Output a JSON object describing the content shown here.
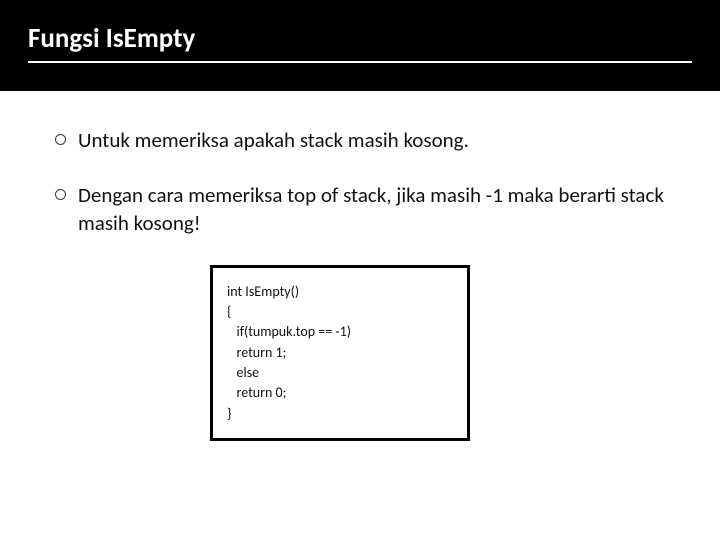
{
  "header": {
    "title": "Fungsi IsEmpty"
  },
  "bullets": [
    "Untuk memeriksa apakah stack masih kosong.",
    "Dengan cara memeriksa top of stack, jika masih -1 maka berarti stack masih kosong!"
  ],
  "code": {
    "line1": "int IsEmpty()",
    "line2": "{",
    "line3": "   if(tumpuk.top == -1)",
    "line4": "   return 1;",
    "line5": "   else",
    "line6": "   return 0;",
    "line7": "}"
  }
}
